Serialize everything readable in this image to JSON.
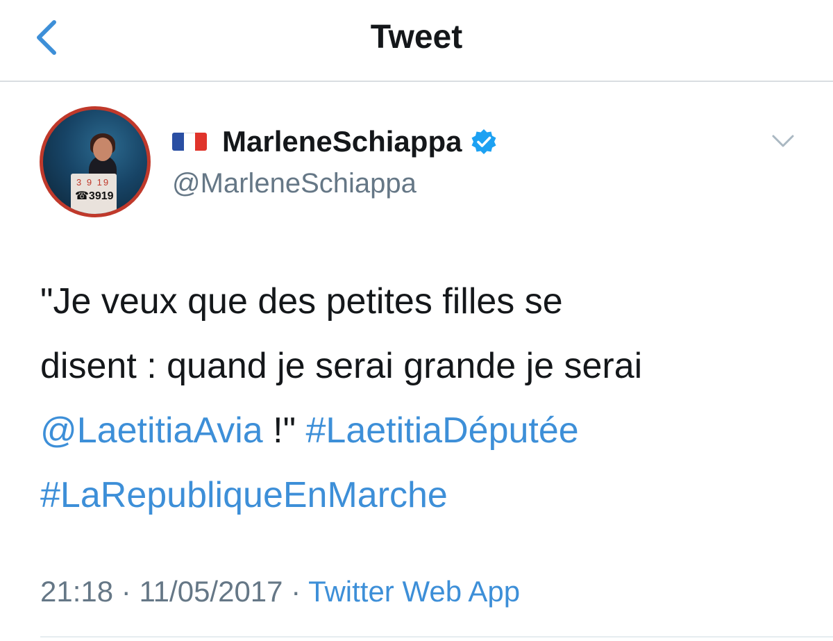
{
  "nav": {
    "title": "Tweet",
    "back_icon": "chevron-left-icon"
  },
  "author": {
    "flag_icon": "france-flag-icon",
    "flag_colors": [
      "#2a4fa3",
      "#ffffff",
      "#e0342b"
    ],
    "display_name": "MarleneSchiappa",
    "verified_icon": "verified-badge-icon",
    "handle": "@MarleneSchiappa",
    "avatar": {
      "lectern_top": "3 9 19",
      "lectern_number": "☎3919"
    },
    "menu_icon": "chevron-down-icon"
  },
  "tweet": {
    "line1": "\"Je veux que des petites filles se",
    "line2": "disent : quand je serai grande je serai",
    "mention": "@LaetitiaAvia",
    "mid_text": " !\" ",
    "hashtag1": "#LaetitiaDéputée",
    "hashtag2": "#LaRepubliqueEnMarche"
  },
  "meta": {
    "time": "21:18",
    "separator": " · ",
    "date": "11/05/2017",
    "source": "Twitter Web App"
  },
  "colors": {
    "link": "#3d8fd8",
    "secondary_text": "#657786",
    "verified": "#1da1f2",
    "avatar_ring": "#c0392b"
  }
}
